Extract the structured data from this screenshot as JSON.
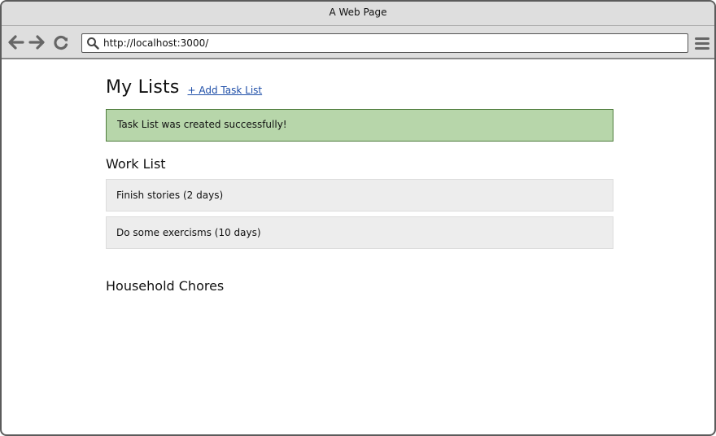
{
  "window": {
    "title": "A Web Page"
  },
  "toolbar": {
    "address": "http://localhost:3000/"
  },
  "page": {
    "title": "My Lists",
    "add_link": "+ Add Task List",
    "flash_message": "Task List was created successfully!",
    "lists": [
      {
        "name": "Work List",
        "tasks": [
          {
            "label": "Finish stories (2 days)"
          },
          {
            "label": "Do some exercisms (10 days)"
          }
        ]
      },
      {
        "name": "Household Chores",
        "tasks": []
      }
    ]
  },
  "colors": {
    "window_border": "#5b5b5b",
    "chrome_background": "#dedede",
    "success_background": "#b7d6aa",
    "success_border": "#4f7d3d",
    "task_background": "#ededed",
    "link": "#1e4ea8"
  },
  "icons": {
    "back": "back-arrow-icon",
    "forward": "forward-arrow-icon",
    "reload": "reload-icon",
    "search": "search-icon",
    "menu": "hamburger-menu-icon"
  }
}
